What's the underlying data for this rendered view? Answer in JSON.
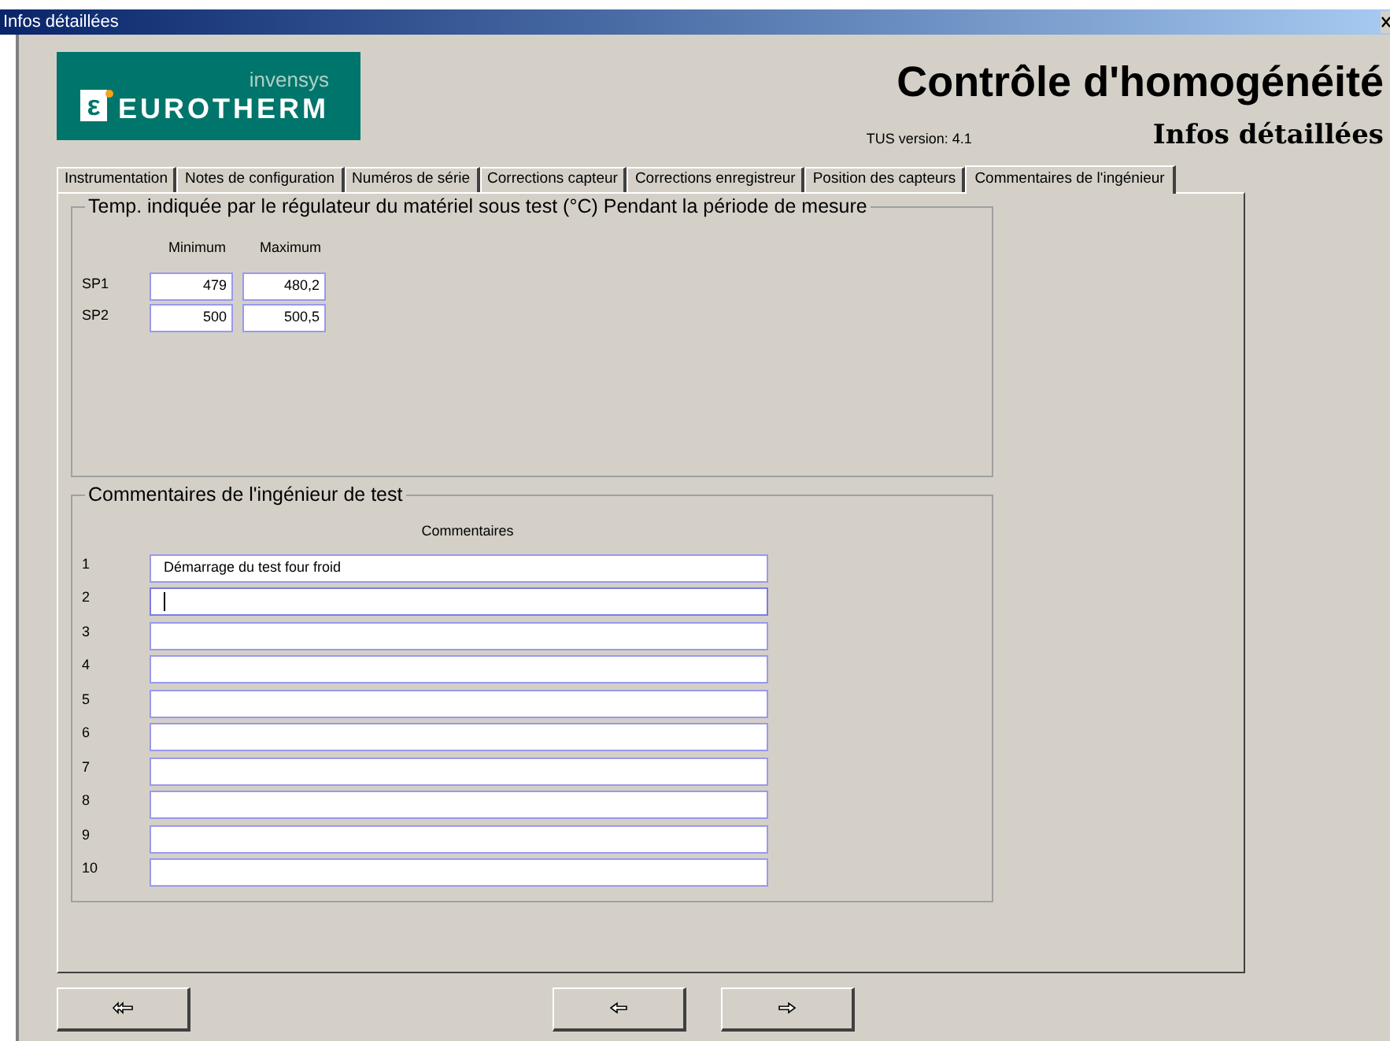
{
  "window": {
    "title": "Infos détaillées"
  },
  "logo": {
    "mark": "ε",
    "brand": "invensys",
    "name": "EUROTHERM"
  },
  "header": {
    "title": "Contrôle d'homogénéité",
    "version": "TUS version: 4.1",
    "subtitle": "Infos détaillées"
  },
  "tabs": [
    {
      "label": "Instrumentation",
      "selected": false
    },
    {
      "label": "Notes de configuration",
      "selected": false
    },
    {
      "label": "Numéros de série",
      "selected": false
    },
    {
      "label": "Corrections capteur",
      "selected": false
    },
    {
      "label": "Corrections enregistreur",
      "selected": false
    },
    {
      "label": "Position des capteurs",
      "selected": false
    },
    {
      "label": "Commentaires de l'ingénieur",
      "selected": true
    }
  ],
  "temperature_group": {
    "title": "Temp. indiquée par le régulateur du matériel sous test (°C) Pendant la période de mesure",
    "columns": [
      "Minimum",
      "Maximum"
    ],
    "rows": [
      {
        "label": "SP1",
        "minimum": "479",
        "maximum": "480,2"
      },
      {
        "label": "SP2",
        "minimum": "500",
        "maximum": "500,5"
      }
    ]
  },
  "comments_group": {
    "title": "Commentaires de l'ingénieur de test",
    "column": "Commentaires",
    "rows": [
      {
        "number": "1",
        "value": "Démarrage du test four froid",
        "focused": false
      },
      {
        "number": "2",
        "focused": true
      },
      {
        "number": "3",
        "focused": false
      },
      {
        "number": "4",
        "focused": false
      },
      {
        "number": "5",
        "focused": false
      },
      {
        "number": "6",
        "focused": false
      },
      {
        "number": "7",
        "focused": false
      },
      {
        "number": "8",
        "focused": false
      },
      {
        "number": "9",
        "focused": false
      },
      {
        "number": "10",
        "focused": false
      }
    ]
  },
  "buttons": [
    {
      "kind": "first"
    },
    {
      "kind": "previous"
    },
    {
      "kind": "next"
    }
  ]
}
